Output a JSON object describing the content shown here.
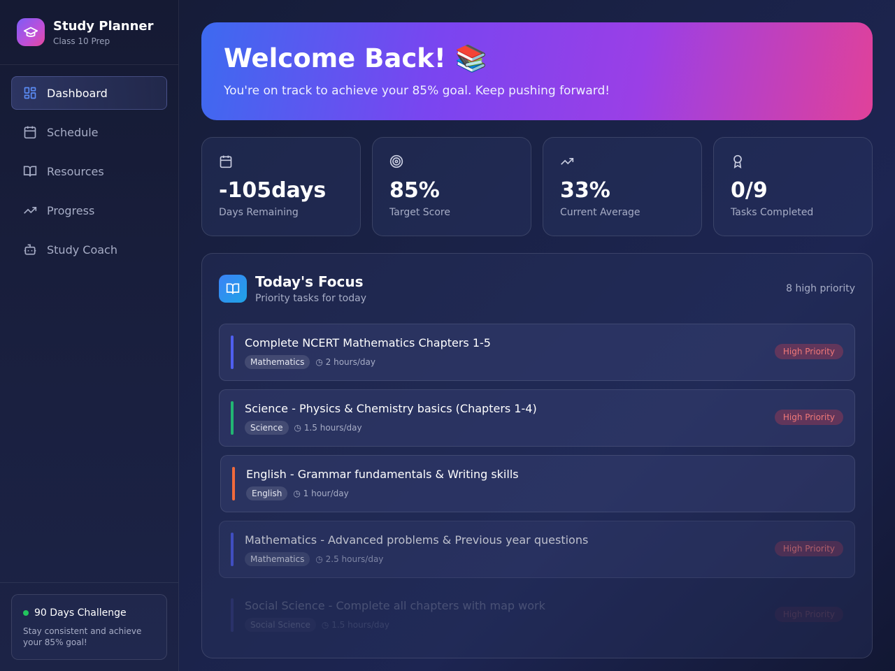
{
  "brand": {
    "title": "Study Planner",
    "subtitle": "Class 10 Prep"
  },
  "nav": [
    {
      "label": "Dashboard",
      "icon": "dashboard-icon",
      "active": true
    },
    {
      "label": "Schedule",
      "icon": "calendar-icon"
    },
    {
      "label": "Resources",
      "icon": "book-open-icon"
    },
    {
      "label": "Progress",
      "icon": "trending-up-icon"
    },
    {
      "label": "Study Coach",
      "icon": "bot-icon"
    }
  ],
  "challenge": {
    "title": "90 Days Challenge",
    "desc": "Stay consistent and achieve your 85% goal!"
  },
  "hero": {
    "title": "Welcome Back! 📚",
    "subtitle": "You're on track to achieve your 85% goal. Keep pushing forward!"
  },
  "stats": [
    {
      "value": "-105days",
      "label": "Days Remaining",
      "icon": "calendar-icon"
    },
    {
      "value": "85%",
      "label": "Target Score",
      "icon": "target-icon"
    },
    {
      "value": "33%",
      "label": "Current Average",
      "icon": "trending-up-icon"
    },
    {
      "value": "0/9",
      "label": "Tasks Completed",
      "icon": "award-icon"
    }
  ],
  "focus": {
    "title": "Today's Focus",
    "subtitle": "Priority tasks for today",
    "count": "8 high priority",
    "tasks": [
      {
        "title": "Complete NCERT Mathematics Chapters 1-5",
        "subject": "Mathematics",
        "time": "2 hours/day",
        "priority": "High Priority",
        "color": "#4f5ff0"
      },
      {
        "title": "Science - Physics & Chemistry basics (Chapters 1-4)",
        "subject": "Science",
        "time": "1.5 hours/day",
        "priority": "High Priority",
        "color": "#22b573"
      },
      {
        "title": "English - Grammar fundamentals & Writing skills",
        "subject": "English",
        "time": "1 hour/day",
        "priority": "",
        "color": "#f06a3c"
      },
      {
        "title": "Mathematics - Advanced problems & Previous year questions",
        "subject": "Mathematics",
        "time": "2.5 hours/day",
        "priority": "High Priority",
        "color": "#4f5ff0"
      },
      {
        "title": "Social Science - Complete all chapters with map work",
        "subject": "Social Science",
        "time": "1.5 hours/day",
        "priority": "High Priority",
        "color": "#5a5fd0"
      }
    ]
  }
}
